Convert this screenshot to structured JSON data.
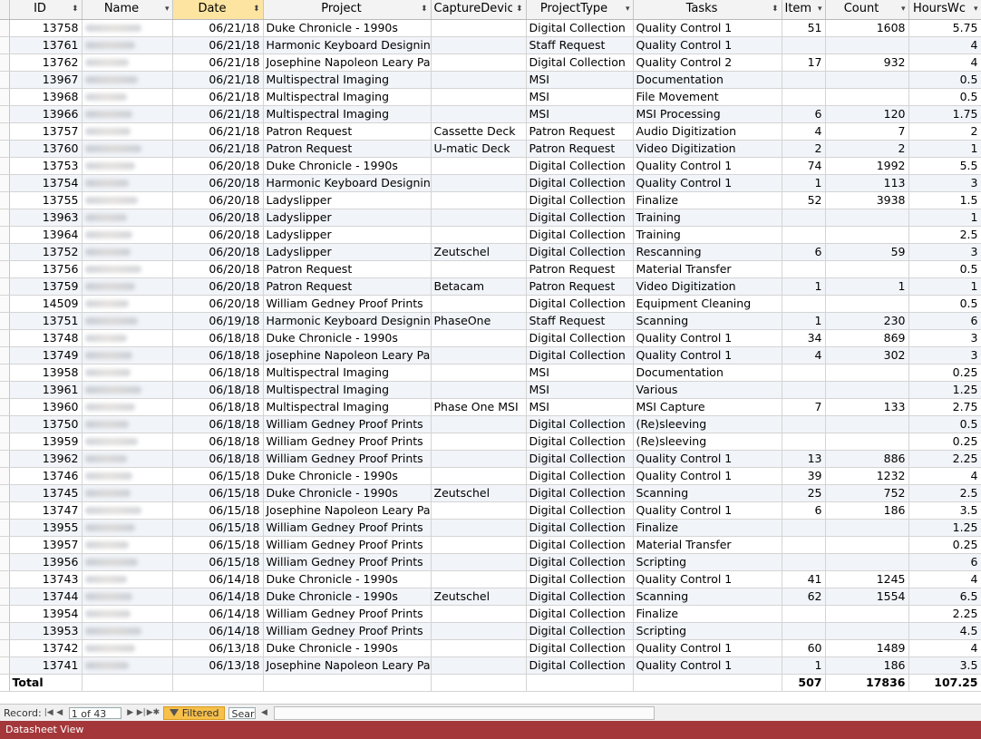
{
  "columns": [
    {
      "key": "selector",
      "label": ""
    },
    {
      "key": "id",
      "label": "ID",
      "arrow": "⬍"
    },
    {
      "key": "name",
      "label": "Name",
      "arrow": "▾"
    },
    {
      "key": "date",
      "label": "Date",
      "arrow": "⬍"
    },
    {
      "key": "project",
      "label": "Project",
      "arrow": "⬍"
    },
    {
      "key": "capture",
      "label": "CaptureDevice",
      "arrow": "⬍"
    },
    {
      "key": "ptype",
      "label": "ProjectType",
      "arrow": "▾"
    },
    {
      "key": "tasks",
      "label": "Tasks",
      "arrow": "⬍"
    },
    {
      "key": "items",
      "label": "Item",
      "arrow": "▾"
    },
    {
      "key": "count",
      "label": "Count",
      "arrow": "▾"
    },
    {
      "key": "hours",
      "label": "HoursWc",
      "arrow": "▾"
    }
  ],
  "rows": [
    {
      "id": "13758",
      "date": "06/21/18",
      "project": "Duke Chronicle - 1990s",
      "capture": "",
      "ptype": "Digital Collection",
      "tasks": "Quality Control 1",
      "items": "51",
      "count": "1608",
      "hours": "5.75"
    },
    {
      "id": "13761",
      "date": "06/21/18",
      "project": "Harmonic Keyboard Designing",
      "capture": "",
      "ptype": "Staff Request",
      "tasks": "Quality Control 1",
      "items": "",
      "count": "",
      "hours": "4"
    },
    {
      "id": "13762",
      "date": "06/21/18",
      "project": "Josephine Napoleon Leary Pap",
      "capture": "",
      "ptype": "Digital Collection",
      "tasks": "Quality Control 2",
      "items": "17",
      "count": "932",
      "hours": "4"
    },
    {
      "id": "13967",
      "date": "06/21/18",
      "project": "Multispectral Imaging",
      "capture": "",
      "ptype": "MSI",
      "tasks": "Documentation",
      "items": "",
      "count": "",
      "hours": "0.5"
    },
    {
      "id": "13968",
      "date": "06/21/18",
      "project": "Multispectral Imaging",
      "capture": "",
      "ptype": "MSI",
      "tasks": "File Movement",
      "items": "",
      "count": "",
      "hours": "0.5"
    },
    {
      "id": "13966",
      "date": "06/21/18",
      "project": "Multispectral Imaging",
      "capture": "",
      "ptype": "MSI",
      "tasks": "MSI Processing",
      "items": "6",
      "count": "120",
      "hours": "1.75"
    },
    {
      "id": "13757",
      "date": "06/21/18",
      "project": "Patron Request",
      "capture": "Cassette Deck",
      "ptype": "Patron Request",
      "tasks": "Audio Digitization",
      "items": "4",
      "count": "7",
      "hours": "2"
    },
    {
      "id": "13760",
      "date": "06/21/18",
      "project": "Patron Request",
      "capture": "U-matic Deck",
      "ptype": "Patron Request",
      "tasks": "Video Digitization",
      "items": "2",
      "count": "2",
      "hours": "1"
    },
    {
      "id": "13753",
      "date": "06/20/18",
      "project": "Duke Chronicle - 1990s",
      "capture": "",
      "ptype": "Digital Collection",
      "tasks": "Quality Control 1",
      "items": "74",
      "count": "1992",
      "hours": "5.5"
    },
    {
      "id": "13754",
      "date": "06/20/18",
      "project": "Harmonic Keyboard Designing",
      "capture": "",
      "ptype": "Digital Collection",
      "tasks": "Quality Control 1",
      "items": "1",
      "count": "113",
      "hours": "3"
    },
    {
      "id": "13755",
      "date": "06/20/18",
      "project": "Ladyslipper",
      "capture": "",
      "ptype": "Digital Collection",
      "tasks": "Finalize",
      "items": "52",
      "count": "3938",
      "hours": "1.5"
    },
    {
      "id": "13963",
      "date": "06/20/18",
      "project": "Ladyslipper",
      "capture": "",
      "ptype": "Digital Collection",
      "tasks": "Training",
      "items": "",
      "count": "",
      "hours": "1"
    },
    {
      "id": "13964",
      "date": "06/20/18",
      "project": "Ladyslipper",
      "capture": "",
      "ptype": "Digital Collection",
      "tasks": "Training",
      "items": "",
      "count": "",
      "hours": "2.5"
    },
    {
      "id": "13752",
      "date": "06/20/18",
      "project": "Ladyslipper",
      "capture": "Zeutschel",
      "ptype": "Digital Collection",
      "tasks": "Rescanning",
      "items": "6",
      "count": "59",
      "hours": "3"
    },
    {
      "id": "13756",
      "date": "06/20/18",
      "project": "Patron Request",
      "capture": "",
      "ptype": "Patron Request",
      "tasks": "Material Transfer",
      "items": "",
      "count": "",
      "hours": "0.5"
    },
    {
      "id": "13759",
      "date": "06/20/18",
      "project": "Patron Request",
      "capture": "Betacam",
      "ptype": "Patron Request",
      "tasks": "Video Digitization",
      "items": "1",
      "count": "1",
      "hours": "1"
    },
    {
      "id": "14509",
      "date": "06/20/18",
      "project": "William Gedney Proof Prints",
      "capture": "",
      "ptype": "Digital Collection",
      "tasks": "Equipment Cleaning",
      "items": "",
      "count": "",
      "hours": "0.5"
    },
    {
      "id": "13751",
      "date": "06/19/18",
      "project": "Harmonic Keyboard Designing",
      "capture": "PhaseOne",
      "ptype": "Staff Request",
      "tasks": "Scanning",
      "items": "1",
      "count": "230",
      "hours": "6"
    },
    {
      "id": "13748",
      "date": "06/18/18",
      "project": "Duke Chronicle - 1990s",
      "capture": "",
      "ptype": "Digital Collection",
      "tasks": "Quality Control 1",
      "items": "34",
      "count": "869",
      "hours": "3"
    },
    {
      "id": "13749",
      "date": "06/18/18",
      "project": "josephine Napoleon Leary Pap",
      "capture": "",
      "ptype": "Digital Collection",
      "tasks": "Quality Control 1",
      "items": "4",
      "count": "302",
      "hours": "3"
    },
    {
      "id": "13958",
      "date": "06/18/18",
      "project": "Multispectral Imaging",
      "capture": "",
      "ptype": "MSI",
      "tasks": "Documentation",
      "items": "",
      "count": "",
      "hours": "0.25"
    },
    {
      "id": "13961",
      "date": "06/18/18",
      "project": "Multispectral Imaging",
      "capture": "",
      "ptype": "MSI",
      "tasks": "Various",
      "items": "",
      "count": "",
      "hours": "1.25"
    },
    {
      "id": "13960",
      "date": "06/18/18",
      "project": "Multispectral Imaging",
      "capture": "Phase One MSI",
      "ptype": "MSI",
      "tasks": "MSI Capture",
      "items": "7",
      "count": "133",
      "hours": "2.75"
    },
    {
      "id": "13750",
      "date": "06/18/18",
      "project": "William Gedney Proof Prints",
      "capture": "",
      "ptype": "Digital Collection",
      "tasks": "(Re)sleeving",
      "items": "",
      "count": "",
      "hours": "0.5"
    },
    {
      "id": "13959",
      "date": "06/18/18",
      "project": "William Gedney Proof Prints",
      "capture": "",
      "ptype": "Digital Collection",
      "tasks": "(Re)sleeving",
      "items": "",
      "count": "",
      "hours": "0.25"
    },
    {
      "id": "13962",
      "date": "06/18/18",
      "project": "William Gedney Proof Prints",
      "capture": "",
      "ptype": "Digital Collection",
      "tasks": "Quality Control 1",
      "items": "13",
      "count": "886",
      "hours": "2.25"
    },
    {
      "id": "13746",
      "date": "06/15/18",
      "project": "Duke Chronicle - 1990s",
      "capture": "",
      "ptype": "Digital Collection",
      "tasks": "Quality Control 1",
      "items": "39",
      "count": "1232",
      "hours": "4"
    },
    {
      "id": "13745",
      "date": "06/15/18",
      "project": "Duke Chronicle - 1990s",
      "capture": "Zeutschel",
      "ptype": "Digital Collection",
      "tasks": "Scanning",
      "items": "25",
      "count": "752",
      "hours": "2.5"
    },
    {
      "id": "13747",
      "date": "06/15/18",
      "project": "Josephine Napoleon Leary Pap",
      "capture": "",
      "ptype": "Digital Collection",
      "tasks": "Quality Control 1",
      "items": "6",
      "count": "186",
      "hours": "3.5"
    },
    {
      "id": "13955",
      "date": "06/15/18",
      "project": "William Gedney Proof Prints",
      "capture": "",
      "ptype": "Digital Collection",
      "tasks": "Finalize",
      "items": "",
      "count": "",
      "hours": "1.25"
    },
    {
      "id": "13957",
      "date": "06/15/18",
      "project": "William Gedney Proof Prints",
      "capture": "",
      "ptype": "Digital Collection",
      "tasks": "Material Transfer",
      "items": "",
      "count": "",
      "hours": "0.25"
    },
    {
      "id": "13956",
      "date": "06/15/18",
      "project": "William Gedney Proof Prints",
      "capture": "",
      "ptype": "Digital Collection",
      "tasks": "Scripting",
      "items": "",
      "count": "",
      "hours": "6"
    },
    {
      "id": "13743",
      "date": "06/14/18",
      "project": "Duke Chronicle - 1990s",
      "capture": "",
      "ptype": "Digital Collection",
      "tasks": "Quality Control 1",
      "items": "41",
      "count": "1245",
      "hours": "4"
    },
    {
      "id": "13744",
      "date": "06/14/18",
      "project": "Duke Chronicle - 1990s",
      "capture": "Zeutschel",
      "ptype": "Digital Collection",
      "tasks": "Scanning",
      "items": "62",
      "count": "1554",
      "hours": "6.5"
    },
    {
      "id": "13954",
      "date": "06/14/18",
      "project": "William Gedney Proof Prints",
      "capture": "",
      "ptype": "Digital Collection",
      "tasks": "Finalize",
      "items": "",
      "count": "",
      "hours": "2.25"
    },
    {
      "id": "13953",
      "date": "06/14/18",
      "project": "William Gedney Proof Prints",
      "capture": "",
      "ptype": "Digital Collection",
      "tasks": "Scripting",
      "items": "",
      "count": "",
      "hours": "4.5"
    },
    {
      "id": "13742",
      "date": "06/13/18",
      "project": "Duke Chronicle - 1990s",
      "capture": "",
      "ptype": "Digital Collection",
      "tasks": "Quality Control 1",
      "items": "60",
      "count": "1489",
      "hours": "4"
    },
    {
      "id": "13741",
      "date": "06/13/18",
      "project": "Josephine Napoleon Leary Pap",
      "capture": "",
      "ptype": "Digital Collection",
      "tasks": "Quality Control 1",
      "items": "1",
      "count": "186",
      "hours": "3.5"
    }
  ],
  "totals": {
    "label": "Total",
    "items": "507",
    "count": "17836",
    "hours": "107.25"
  },
  "nav": {
    "record_label": "Record:",
    "record_value": "1 of 43",
    "filter_label": "Filtered",
    "search_placeholder": "Searc"
  },
  "status_bar": {
    "text": "Datasheet View"
  },
  "colors": {
    "sorted_header": "#fde5a1",
    "status_bar": "#a4373a",
    "filter_badge": "#f7c04a"
  }
}
